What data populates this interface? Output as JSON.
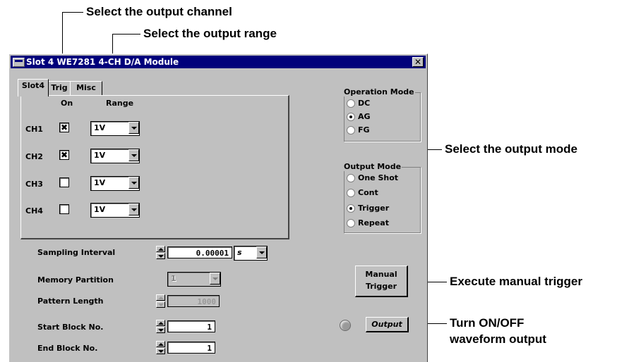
{
  "annotations": {
    "select_channel": "Select the output channel",
    "select_range": "Select the output range",
    "select_mode": "Select the output mode",
    "manual_trigger": "Execute manual trigger",
    "turn_output_line1": "Turn ON/OFF",
    "turn_output_line2": "waveform output"
  },
  "window": {
    "title": "Slot 4 WE7281 4-CH D/A Module",
    "close_glyph": "✕"
  },
  "tabs": [
    {
      "label": "Slot4",
      "active": true
    },
    {
      "label": "Trig",
      "active": false
    },
    {
      "label": "Misc",
      "active": false
    }
  ],
  "channels": {
    "on_header": "On",
    "range_header": "Range",
    "rows": [
      {
        "label": "CH1",
        "on": true,
        "check_glyph": "✖",
        "range": "1V"
      },
      {
        "label": "CH2",
        "on": true,
        "check_glyph": "✖",
        "range": "1V"
      },
      {
        "label": "CH3",
        "on": false,
        "check_glyph": "",
        "range": "1V"
      },
      {
        "label": "CH4",
        "on": false,
        "check_glyph": "",
        "range": "1V"
      }
    ]
  },
  "operation_mode": {
    "title": "Operation Mode",
    "options": [
      "DC",
      "AG",
      "FG"
    ],
    "selected": "AG"
  },
  "output_mode": {
    "title": "Output Mode",
    "options": [
      "One Shot",
      "Cont",
      "Trigger",
      "Repeat"
    ],
    "selected": "Trigger"
  },
  "settings": {
    "sampling_interval_label": "Sampling Interval",
    "sampling_interval_value": "0.00001",
    "sampling_unit": "s",
    "memory_partition_label": "Memory Partition",
    "memory_partition_value": "1",
    "pattern_length_label": "Pattern Length",
    "pattern_length_value": "1000",
    "start_block_label": "Start Block No.",
    "start_block_value": "1",
    "end_block_label": "End Block No.",
    "end_block_value": "1"
  },
  "buttons": {
    "manual_trigger_line1": "Manual",
    "manual_trigger_line2": "Trigger",
    "output": "Output"
  },
  "colors": {
    "title_bar": "#00007b",
    "dialog_face": "#c0c0c0",
    "led_off": "#9a9a9a"
  }
}
